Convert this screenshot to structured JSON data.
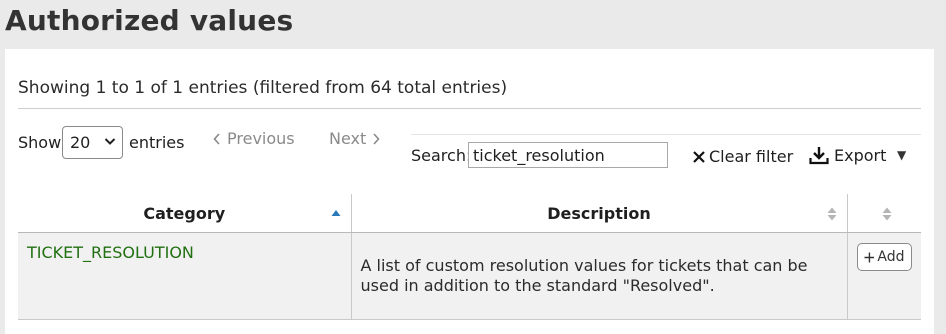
{
  "page": {
    "title": "Authorized values"
  },
  "info": {
    "text": "Showing 1 to 1 of 1 entries (filtered from 64 total entries)"
  },
  "length_menu": {
    "show_label": "Show",
    "selected": "20",
    "entries_label": "entries"
  },
  "pagination": {
    "previous_label": "Previous",
    "next_label": "Next"
  },
  "search": {
    "label": "Search:",
    "value": "ticket_resolution"
  },
  "toolbar": {
    "clear_filter_label": "Clear filter",
    "export_label": "Export"
  },
  "table": {
    "columns": [
      {
        "label": "Category",
        "sort": "ascending"
      },
      {
        "label": "Description",
        "sort": "none"
      },
      {
        "label": "",
        "sort": "none"
      }
    ],
    "rows": [
      {
        "category": "TICKET_RESOLUTION",
        "description": "A list of custom resolution values for tickets that can be used in addition to the standard \"Resolved\".",
        "action_label": "Add"
      }
    ]
  },
  "colors": {
    "link_green": "#217011",
    "sort_active": "#2a7ab9",
    "sort_inactive": "#b5b5b5",
    "row_background": "#f1f1f1"
  }
}
